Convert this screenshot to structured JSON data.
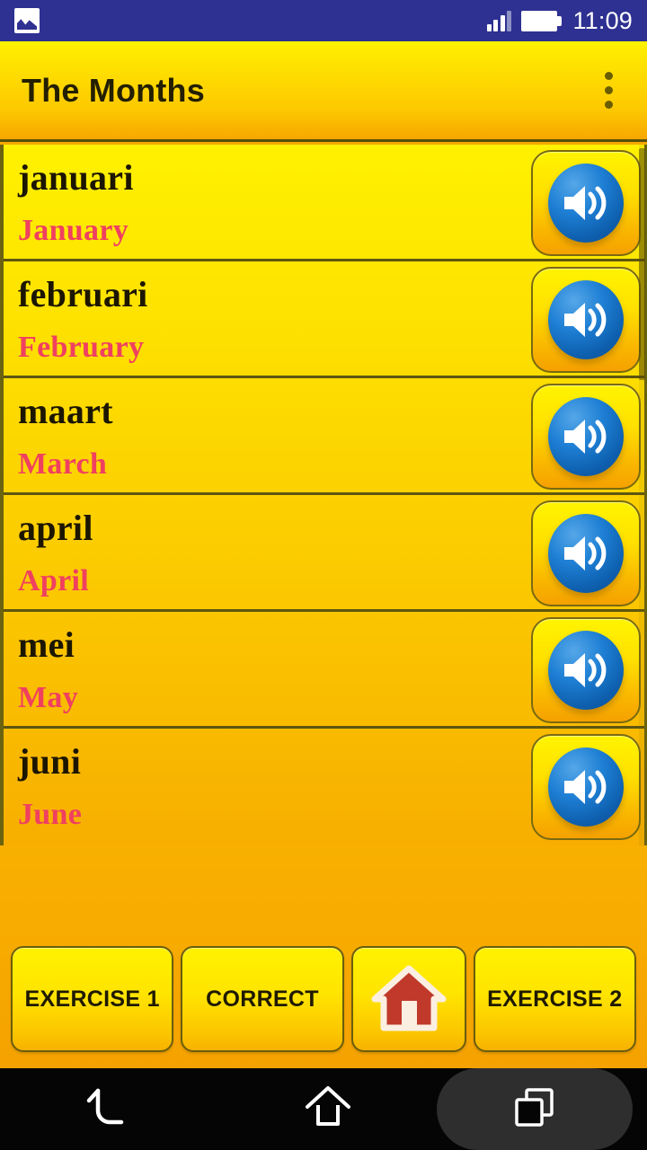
{
  "status_bar": {
    "notification_icon": "screenshot-image-icon",
    "signal_icon": "signal-bars-icon",
    "battery_icon": "battery-full-icon",
    "time": "11:09",
    "background_color": "#2E3191"
  },
  "app_bar": {
    "title": "The Months",
    "overflow_icon": "overflow-menu-icon",
    "accent_color": "#FFE500",
    "title_color": "#241f00"
  },
  "list": {
    "native_color": "#1c1600",
    "english_color": "#F04060",
    "speaker_icon": "speaker-volume-icon",
    "rows": [
      {
        "native": "januari",
        "english": "January"
      },
      {
        "native": "februari",
        "english": "February"
      },
      {
        "native": "maart",
        "english": "March"
      },
      {
        "native": "april",
        "english": "April"
      },
      {
        "native": "mei",
        "english": "May"
      },
      {
        "native": "juni",
        "english": "June"
      }
    ]
  },
  "scrollbar": {
    "position": "top",
    "thumb_fraction": "0.33"
  },
  "buttons": {
    "exercise1": "EXERCISE 1",
    "correct": "CORRECT",
    "home_icon": "home-house-icon",
    "exercise2": "EXERCISE 2"
  },
  "nav_bar": {
    "back_icon": "back-arrow-icon",
    "home_icon": "home-outline-icon",
    "recents_icon": "recents-squares-icon",
    "background_color": "#050505"
  }
}
